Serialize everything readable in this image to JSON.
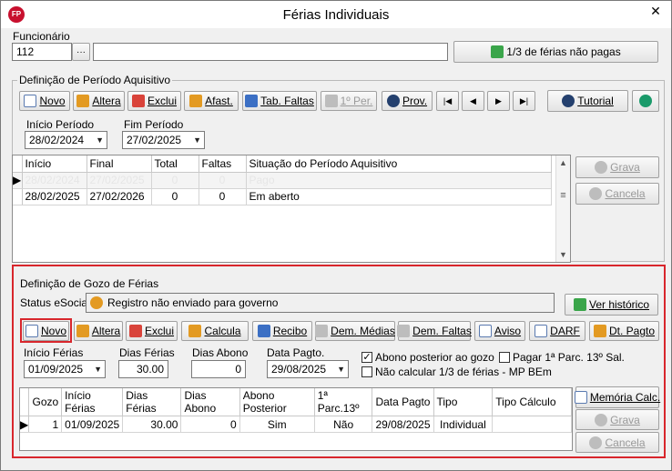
{
  "window": {
    "title": "Férias Individuais",
    "app_icon_text": "FP",
    "close_glyph": "✕"
  },
  "funcionario": {
    "label": "Funcionário",
    "code": "112",
    "lookup_glyph": "···",
    "name": "",
    "status_button": "1/3 de férias não pagas"
  },
  "periodo": {
    "group_title": "Definição de Período Aquisitivo",
    "toolbar": {
      "novo": "Novo",
      "altera": "Altera",
      "exclui": "Exclui",
      "afast": "Afast.",
      "tab_faltas": "Tab. Faltas",
      "primeiro_per": "1º Per.",
      "prov": "Prov.",
      "nav_first": "|◀",
      "nav_prev": "◀",
      "nav_next": "▶",
      "nav_last": "▶|",
      "tutorial": "Tutorial"
    },
    "inicio_label": "Início Período",
    "inicio_value": "28/02/2024",
    "fim_label": "Fim Período",
    "fim_value": "27/02/2025",
    "columns": [
      "Início",
      "Final",
      "Total",
      "Faltas",
      "Situação do Período Aquisitivo"
    ],
    "rows": [
      {
        "inicio": "28/02/2024",
        "final": "27/02/2025",
        "total": "0",
        "faltas": "0",
        "situacao": "Pago"
      },
      {
        "inicio": "28/02/2025",
        "final": "27/02/2026",
        "total": "0",
        "faltas": "0",
        "situacao": "Em aberto"
      }
    ],
    "grava": "Grava",
    "cancela": "Cancela"
  },
  "gozo": {
    "group_title": "Definição de Gozo de Férias",
    "status_label": "Status eSocial:",
    "status_value": "Registro não enviado para governo",
    "ver_historico": "Ver histórico",
    "toolbar": {
      "novo": "Novo",
      "altera": "Altera",
      "exclui": "Exclui",
      "calcula": "Calcula",
      "recibo": "Recibo",
      "dem_medias": "Dem. Médias",
      "dem_faltas": "Dem. Faltas",
      "aviso": "Aviso",
      "darf": "DARF",
      "dt_pagto": "Dt. Pagto"
    },
    "inicio_label": "Início Férias",
    "inicio_value": "01/09/2025",
    "dias_ferias_label": "Dias Férias",
    "dias_ferias_value": "30.00",
    "dias_abono_label": "Dias Abono",
    "dias_abono_value": "0",
    "data_pagto_label": "Data Pagto.",
    "data_pagto_value": "29/08/2025",
    "chk_abono": "Abono posterior ao gozo",
    "chk_abono_checked": "✓",
    "chk_nao_calcular": "Não calcular 1/3 de férias - MP BEm",
    "chk_pagar": "Pagar 1ª Parc. 13º Sal.",
    "columns": [
      "Gozo",
      "Início Férias",
      "Dias Férias",
      "Dias Abono",
      "Abono Posterior",
      "1ª Parc.13º",
      "Data Pagto",
      "Tipo",
      "Tipo Cálculo"
    ],
    "rows": [
      {
        "gozo": "1",
        "inicio": "01/09/2025",
        "dias_ferias": "30.00",
        "dias_abono": "0",
        "abono_posterior": "Sim",
        "parc13": "Não",
        "data_pagto": "29/08/2025",
        "tipo": "Individual",
        "tipo_calculo": ""
      }
    ],
    "memoria_calc": "Memória Calc.",
    "grava": "Grava",
    "cancela": "Cancela"
  }
}
